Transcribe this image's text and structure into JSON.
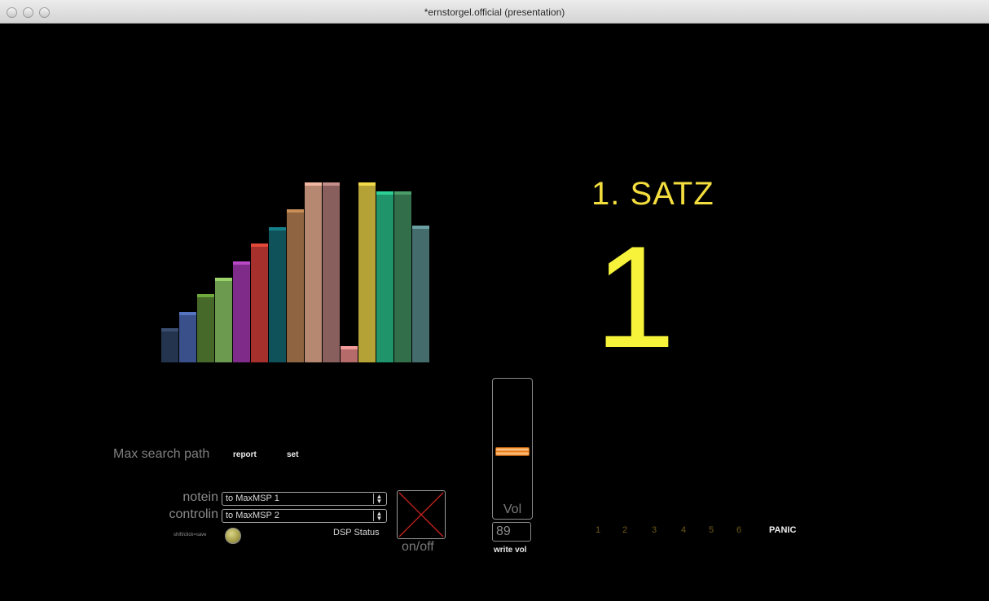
{
  "window": {
    "title": "*ernstorgel.official (presentation)"
  },
  "section": {
    "title": "1. SATZ",
    "number": "1"
  },
  "bars": [
    {
      "level": 0.19,
      "color": "#25344e",
      "cap": "#3a4e70"
    },
    {
      "level": 0.28,
      "color": "#39508a",
      "cap": "#5574c0"
    },
    {
      "level": 0.38,
      "color": "#46692a",
      "cap": "#6fa83c"
    },
    {
      "level": 0.47,
      "color": "#6c9a4e",
      "cap": "#9ad36a"
    },
    {
      "level": 0.56,
      "color": "#7f2b8a",
      "cap": "#b848c6"
    },
    {
      "level": 0.66,
      "color": "#a6302b",
      "cap": "#e44a3a"
    },
    {
      "level": 0.75,
      "color": "#0f525a",
      "cap": "#16808a"
    },
    {
      "level": 0.85,
      "color": "#8e6540",
      "cap": "#c98d58"
    },
    {
      "level": 1.0,
      "color": "#b68872",
      "cap": "#f0b8a0"
    },
    {
      "level": 1.0,
      "color": "#885f5c",
      "cap": "#c48e8a"
    },
    {
      "level": 0.09,
      "color": "#b56b6a",
      "cap": "#f29a9a"
    },
    {
      "level": 1.0,
      "color": "#b4a236",
      "cap": "#f2d94a"
    },
    {
      "level": 0.95,
      "color": "#1f946a",
      "cap": "#2cd094"
    },
    {
      "level": 0.95,
      "color": "#336e4a",
      "cap": "#4a9c68"
    },
    {
      "level": 0.76,
      "color": "#456c6d",
      "cap": "#6aa0a2"
    }
  ],
  "volume": {
    "label": "Vol",
    "value": "89",
    "level": 0.47,
    "write_label": "write vol"
  },
  "search_path": {
    "label": "Max search path",
    "report": "report",
    "set": "set"
  },
  "midi": {
    "notein_label": "notein",
    "notein_value": "to MaxMSP 1",
    "controlin_label": "controlin",
    "controlin_value": "to MaxMSP 2"
  },
  "misc": {
    "shift_note": "shift/click=save",
    "dsp_status": "DSP Status",
    "onoff_label": "on/off"
  },
  "presets": {
    "items": [
      "1",
      "2",
      "3",
      "4",
      "5",
      "6"
    ],
    "panic": "PANIC"
  }
}
